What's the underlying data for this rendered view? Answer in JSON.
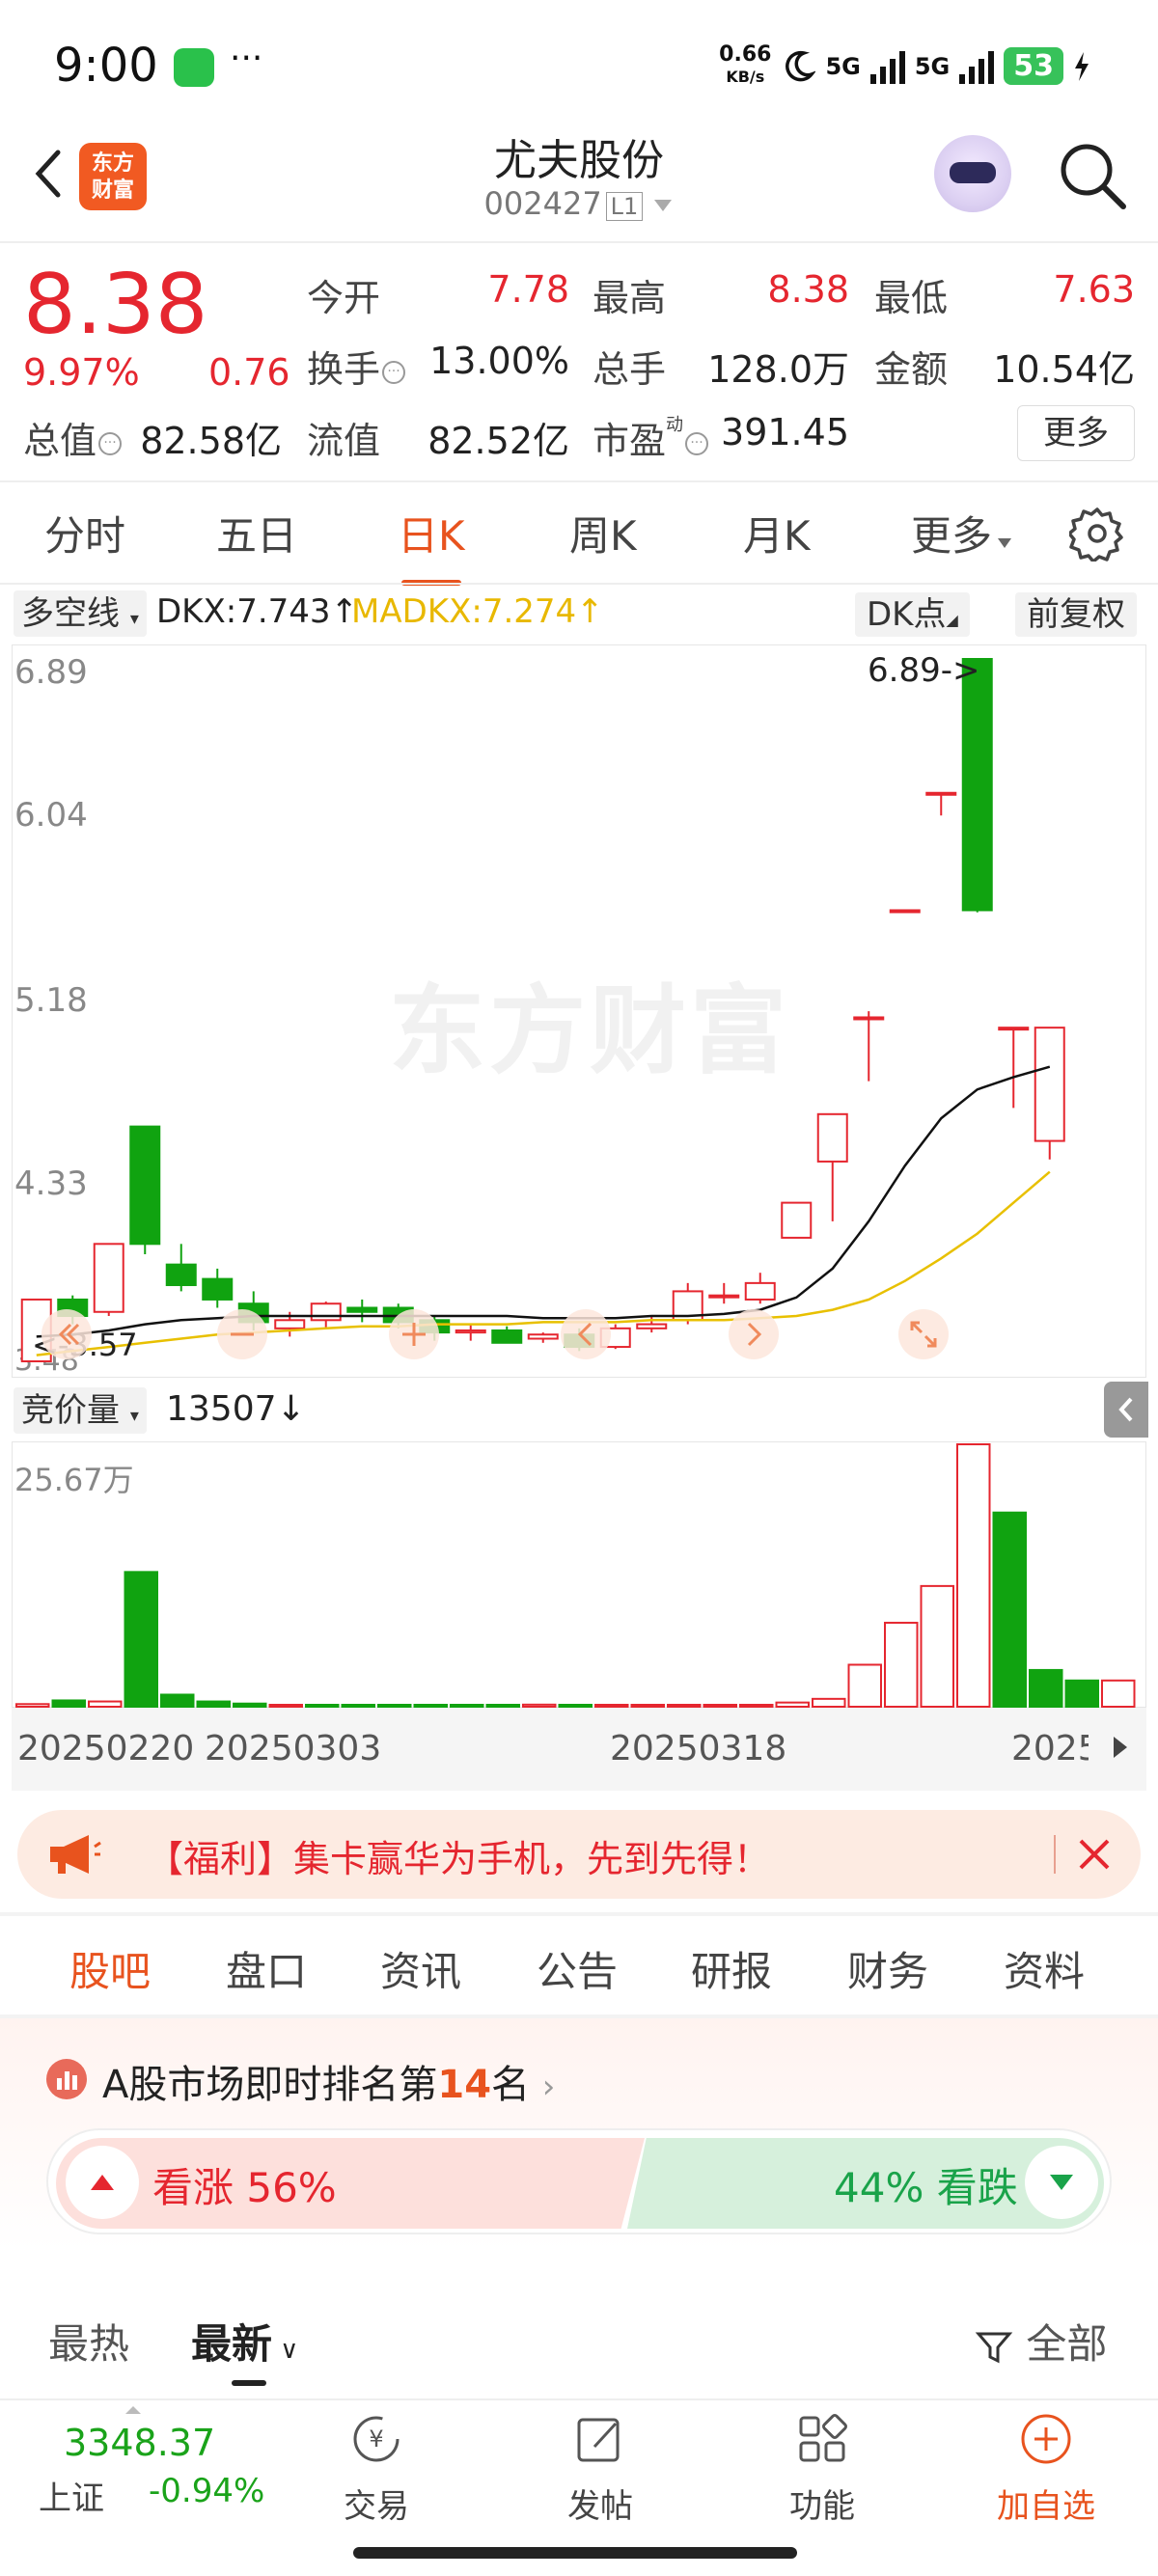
{
  "status_bar": {
    "time": "9:00",
    "more": "···",
    "net_speed_top": "0.66",
    "net_speed_unit": "KB/s",
    "signal1": "5G",
    "signal2": "5G",
    "battery": "53",
    "icons": [
      "wechat-icon",
      "moon-icon",
      "signal-icon",
      "battery-icon",
      "charging-icon"
    ]
  },
  "header": {
    "logo_text_line1": "东方",
    "logo_text_line2": "财富",
    "stock_name": "尤夫股份",
    "stock_code": "002427",
    "level_badge": "L1"
  },
  "quote": {
    "price": "8.38",
    "change_pct": "9.97%",
    "change": "0.76",
    "rows": [
      [
        {
          "label": "今开",
          "value": "7.78",
          "color": "#e5262f"
        },
        {
          "label": "最高",
          "value": "8.38",
          "color": "#e5262f"
        },
        {
          "label": "最低",
          "value": "7.63",
          "color": "#e5262f"
        }
      ],
      [
        {
          "label": "换手",
          "value": "13.00%",
          "color": "#222222"
        },
        {
          "label": "总手",
          "value": "128.0万",
          "color": "#222222"
        },
        {
          "label": "金额",
          "value": "10.54亿",
          "color": "#222222"
        }
      ],
      [
        {
          "label": "总值",
          "value": "82.58亿",
          "color": "#222222"
        },
        {
          "label": "流值",
          "value": "82.52亿",
          "color": "#222222"
        },
        {
          "label": "市盈",
          "value": "391.45",
          "color": "#222222"
        }
      ]
    ],
    "pe_superscript": "动",
    "more_button": "更多"
  },
  "period_tabs": [
    "分时",
    "五日",
    "日K",
    "周K",
    "月K",
    "更多"
  ],
  "active_period": "日K",
  "indicator": {
    "selector": "多空线",
    "dkx": "DKX:7.743",
    "madkx": "MADKX:7.274",
    "dk_button": "DK点",
    "adjust_button": "前复权"
  },
  "kline": {
    "y_labels": [
      "6.89",
      "6.04",
      "5.18",
      "4.33",
      "3.48"
    ],
    "max_annotation": "6.89->",
    "min_annotation": "<-3.57",
    "watermark": "东方财富",
    "up_color": "#e5262f",
    "down_color": "#10a310",
    "dkx_color": "#111111",
    "madkx_color": "#e8c000"
  },
  "chart_data": {
    "type": "candlestick",
    "y_range": [
      3.48,
      6.89
    ],
    "candles": [
      {
        "o": 3.48,
        "c": 3.78,
        "h": 3.78,
        "l": 3.48
      },
      {
        "o": 3.78,
        "c": 3.7,
        "h": 3.8,
        "l": 3.66
      },
      {
        "o": 3.72,
        "c": 4.05,
        "h": 4.05,
        "l": 3.7
      },
      {
        "o": 4.62,
        "c": 4.05,
        "h": 4.62,
        "l": 4.0
      },
      {
        "o": 3.95,
        "c": 3.85,
        "h": 4.05,
        "l": 3.82
      },
      {
        "o": 3.88,
        "c": 3.78,
        "h": 3.93,
        "l": 3.74
      },
      {
        "o": 3.76,
        "c": 3.67,
        "h": 3.82,
        "l": 3.63
      },
      {
        "o": 3.64,
        "c": 3.68,
        "h": 3.72,
        "l": 3.6
      },
      {
        "o": 3.68,
        "c": 3.76,
        "h": 3.77,
        "l": 3.64
      },
      {
        "o": 3.74,
        "c": 3.72,
        "h": 3.78,
        "l": 3.67
      },
      {
        "o": 3.74,
        "c": 3.67,
        "h": 3.76,
        "l": 3.64
      },
      {
        "o": 3.68,
        "c": 3.62,
        "h": 3.7,
        "l": 3.58
      },
      {
        "o": 3.62,
        "c": 3.63,
        "h": 3.66,
        "l": 3.58
      },
      {
        "o": 3.63,
        "c": 3.57,
        "h": 3.65,
        "l": 3.57
      },
      {
        "o": 3.59,
        "c": 3.61,
        "h": 3.62,
        "l": 3.57
      },
      {
        "o": 3.61,
        "c": 3.55,
        "h": 3.64,
        "l": 3.53
      },
      {
        "o": 3.55,
        "c": 3.64,
        "h": 3.66,
        "l": 3.54
      },
      {
        "o": 3.64,
        "c": 3.66,
        "h": 3.7,
        "l": 3.62
      },
      {
        "o": 3.68,
        "c": 3.82,
        "h": 3.86,
        "l": 3.66
      },
      {
        "o": 3.8,
        "c": 3.8,
        "h": 3.86,
        "l": 3.76
      },
      {
        "o": 3.78,
        "c": 3.86,
        "h": 3.91,
        "l": 3.76
      },
      {
        "o": 4.08,
        "c": 4.25,
        "h": 4.25,
        "l": 4.08
      },
      {
        "o": 4.45,
        "c": 4.68,
        "h": 4.68,
        "l": 4.16
      },
      {
        "o": 5.15,
        "c": 5.15,
        "h": 5.18,
        "l": 4.84
      },
      {
        "o": 5.67,
        "c": 5.67,
        "h": 5.67,
        "l": 5.67
      },
      {
        "o": 6.24,
        "c": 6.24,
        "h": 6.24,
        "l": 6.13
      },
      {
        "o": 6.89,
        "c": 5.67,
        "h": 6.89,
        "l": 5.66
      },
      {
        "o": 5.1,
        "c": 5.1,
        "h": 5.1,
        "l": 4.71
      },
      {
        "o": 4.55,
        "c": 5.1,
        "h": 5.1,
        "l": 4.46
      }
    ],
    "dkx": [
      3.6,
      3.61,
      3.63,
      3.66,
      3.68,
      3.69,
      3.7,
      3.7,
      3.7,
      3.7,
      3.7,
      3.7,
      3.7,
      3.7,
      3.69,
      3.69,
      3.69,
      3.7,
      3.7,
      3.71,
      3.73,
      3.79,
      3.93,
      4.16,
      4.43,
      4.66,
      4.8,
      4.86,
      4.91
    ],
    "madkx": [
      3.51,
      3.53,
      3.55,
      3.57,
      3.59,
      3.61,
      3.62,
      3.63,
      3.64,
      3.65,
      3.65,
      3.66,
      3.66,
      3.66,
      3.67,
      3.67,
      3.67,
      3.68,
      3.68,
      3.68,
      3.69,
      3.7,
      3.73,
      3.78,
      3.87,
      3.98,
      4.1,
      4.25,
      4.4
    ],
    "volume_label": "竞价量",
    "volume_value": "13507",
    "volume_max_label": "25.67万",
    "volume_max": 25.67,
    "volumes": [
      0.5,
      1.2,
      1.0,
      25.67,
      2.3,
      1.0,
      0.6,
      0.3,
      0.3,
      0.2,
      0.2,
      0.3,
      0.2,
      0.2,
      0.4,
      0.2,
      0.2,
      0.2,
      0.3,
      0.2,
      0.3,
      0.8,
      1.5,
      8.0,
      16.0,
      23.0,
      50.0,
      37.0,
      7.0,
      5.0,
      5.0
    ],
    "volume_up": [
      true,
      false,
      true,
      false,
      false,
      false,
      false,
      true,
      false,
      false,
      false,
      false,
      false,
      false,
      true,
      false,
      true,
      true,
      true,
      true,
      true,
      true,
      true,
      true,
      true,
      true,
      true,
      false,
      false,
      false,
      true
    ],
    "x_labels": [
      "20250220",
      "20250303",
      "20250318",
      "2025"
    ]
  },
  "promo": {
    "text": "【福利】集卡赢华为手机，先到先得！"
  },
  "content_tabs": [
    "股吧",
    "盘口",
    "资讯",
    "公告",
    "研报",
    "财务",
    "资料"
  ],
  "active_content_tab": "股吧",
  "sentiment": {
    "rank_prefix": "A股市场即时排名第",
    "rank_number": "14",
    "rank_suffix": "名",
    "up_label": "看涨 56%",
    "down_label": "44% 看跌",
    "up_pct": 56
  },
  "sort": {
    "hot": "最热",
    "latest": "最新",
    "filter": "全部"
  },
  "bottom_nav": {
    "index_value": "3348.37",
    "index_name": "上证",
    "index_change": "-0.94%",
    "items": [
      "交易",
      "发帖",
      "功能",
      "加自选"
    ]
  }
}
